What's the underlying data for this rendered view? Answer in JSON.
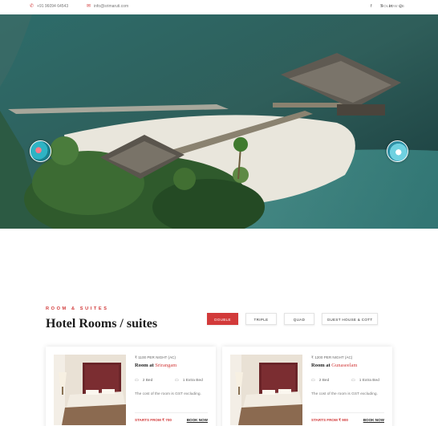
{
  "topbar": {
    "phone_icon": "phone-icon",
    "phone": "+91 96094 64543",
    "email_icon": "mail-icon",
    "email": "info@srimaruti.com",
    "follow_label": "FOLLOW US",
    "social": [
      {
        "icon": "facebook-icon",
        "glyph": "f"
      },
      {
        "icon": "skype-icon",
        "glyph": "S"
      },
      {
        "icon": "linkedin-icon",
        "glyph": "in"
      },
      {
        "icon": "instagram-icon",
        "glyph": "◎"
      }
    ]
  },
  "hero": {
    "prev_icon": "slide-prev-thumbnail",
    "next_icon": "slide-next-thumbnail"
  },
  "section": {
    "eyebrow": "ROOM & SUITES",
    "title": "Hotel Rooms / suites"
  },
  "tabs": [
    {
      "label": "DOUBLE",
      "active": true
    },
    {
      "label": "TRIPLE",
      "active": false
    },
    {
      "label": "QUAD",
      "active": false
    },
    {
      "label": "GUEST HOUSE & COTT",
      "active": false
    }
  ],
  "rooms": [
    {
      "price": "₹ 1100 PER NIGHT (AC)",
      "name_prefix": "Room at",
      "location": "Srirangam",
      "bed": "2 Bed",
      "extra": "1 Extra Bed",
      "desc": "The cost of the room is GST excluding.",
      "starts": "STARTS FROM ₹ 700",
      "book": "BOOK NOW"
    },
    {
      "price": "₹ 1200 PER NIGHT (AC)",
      "name_prefix": "Room at",
      "location": "Gunaseelam",
      "bed": "2 Bed",
      "extra": "1 Extra Bed",
      "desc": "The cost of the room is GST excluding.",
      "starts": "STARTS FROM ₹ 900",
      "book": "BOOK NOW"
    }
  ],
  "colors": {
    "accent": "#d23a3a",
    "heading": "#1c1c1c"
  }
}
